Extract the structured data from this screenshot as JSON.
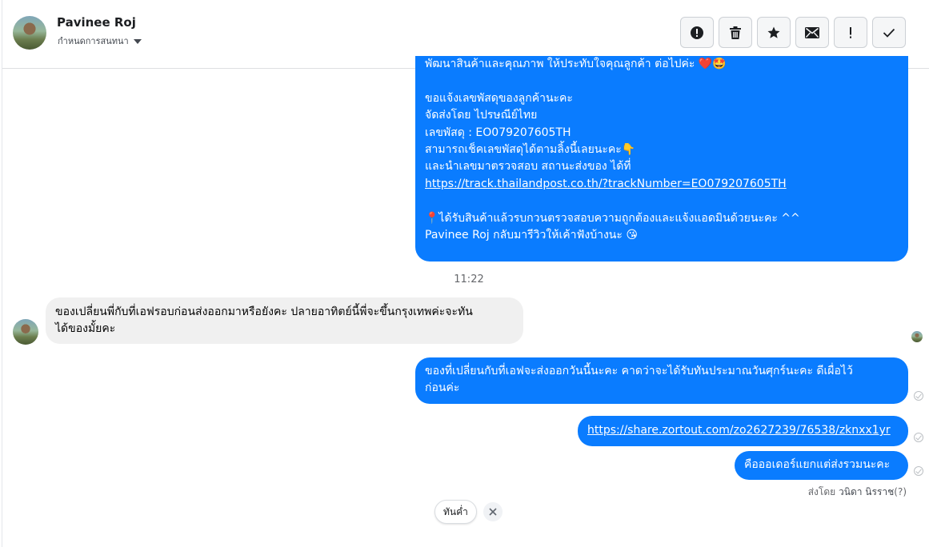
{
  "header": {
    "contact_name": "Pavinee Roj",
    "assign_label": "กำหนดการสนทนา",
    "actions": [
      "spam",
      "delete",
      "star",
      "mark-unread",
      "priority",
      "done"
    ]
  },
  "messages": {
    "order_notice": {
      "line1": "พัฒนาสินค้าและคุณภาพ ให้ประทับใจคุณลูกค้า ต่อไปค่ะ ❤️🤩",
      "line2": "ขอแจ้งเลขพัสดุของลูกค้านะคะ",
      "line3": "จัดส่งโดย ไปรษณีย์ไทย",
      "line4": "เลขพัสดุ : EO079207605TH",
      "line5": "สามารถเช็คเลขพัสดุได้ตามลิ้งนี้เลยนะคะ👇",
      "line6": "และนำเลขมาตรวจสอบ สถานะส่งของ  ได้ที่",
      "link": "https://track.thailandpost.co.th/?trackNumber=EO079207605TH",
      "line8": "📍ได้รับสินค้าแล้วรบกวนตรวจสอบความถูกต้องและแจ้งแอดมินด้วยนะคะ ^^",
      "line9": "Pavinee Roj กลับมารีวิวให้เค้าฟังบ้างนะ 😘"
    },
    "timestamp": "11:22",
    "customer_msg": {
      "line1": "ของเปลี่ยนพี่กับที่เอฟรอบก่อนส่งออกมาหรือยังคะ ปลายอาทิตย์นี้พี่จะขึ้นกรุงเทพค่ะจะทัน",
      "line2": "ได้ของมั้ยคะ"
    },
    "reply1": {
      "line1": "ของที่เปลี่ยนกับที่เอฟจะส่งออกวันนี้นะคะ คาดว่าจะได้รับทันประมาณวันศุกร์นะคะ ดีเผื่อไว้",
      "line2": "ก่อนค่ะ"
    },
    "reply2_link": "https://share.zortout.com/zo2627239/76538/zknxx1yr",
    "reply3": "คือออเดอร์แยกแต่ส่งรวมนะคะ",
    "sent_by_prefix": "ส่งโดย",
    "sent_by_name": "วนิดา นิรราช",
    "sent_by_help": "(?)"
  },
  "quick_reply": {
    "chip_label": "ทันค่ำ"
  },
  "colors": {
    "outgoing_bubble": "#0a7cff",
    "incoming_bubble": "#f0f0f0"
  }
}
